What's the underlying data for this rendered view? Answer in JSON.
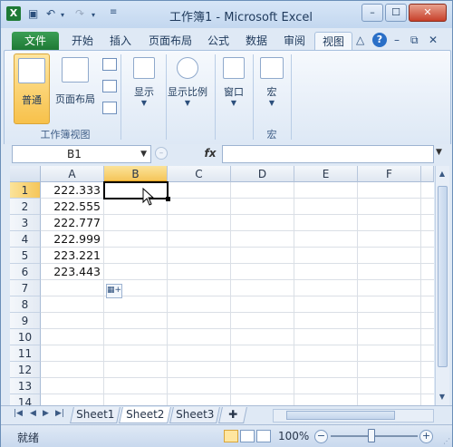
{
  "window": {
    "title": "工作簿1 - Microsoft Excel",
    "app_icon": "X",
    "quick_access": [
      "save-icon",
      "undo-icon",
      "redo-icon",
      "customize-icon"
    ],
    "controls": {
      "minimize": "–",
      "maximize": "☐",
      "close": "✕"
    }
  },
  "ribbon_tabs": [
    "文件",
    "开始",
    "插入",
    "页面布局",
    "公式",
    "数据",
    "审阅",
    "视图"
  ],
  "active_tab": "视图",
  "ribbon_right_icons": {
    "collapse": "△",
    "help": "?",
    "minimize": "–",
    "restore": "⧉",
    "close": "✕"
  },
  "ribbon": {
    "workbook_views": {
      "normal": "普通",
      "page_layout": "页面布局",
      "group_label": "工作簿视图"
    },
    "show": "显示",
    "zoom": "显示比例",
    "window": "窗口",
    "macros": {
      "label": "宏",
      "group_label": "宏"
    }
  },
  "formula_bar": {
    "name_box": "B1",
    "fx": "fx",
    "formula": ""
  },
  "columns": [
    "A",
    "B",
    "C",
    "D",
    "E",
    "F"
  ],
  "selected_column": "B",
  "rows": [
    "1",
    "2",
    "3",
    "4",
    "5",
    "6",
    "7",
    "8",
    "9",
    "10",
    "11",
    "12",
    "13",
    "14"
  ],
  "selected_row": "1",
  "cells_A": [
    "222.333",
    "222.555",
    "222.777",
    "222.999",
    "223.221",
    "223.443"
  ],
  "sheets": [
    "Sheet1",
    "Sheet2",
    "Sheet3"
  ],
  "active_sheet": "Sheet2",
  "status": {
    "ready": "就绪",
    "zoom": "100%",
    "zoom_minus": "−",
    "zoom_plus": "+"
  },
  "colors": {
    "file_tab": "#1e7a35",
    "selection_header": "#f5c65a",
    "accent": "#2a6fc7"
  }
}
